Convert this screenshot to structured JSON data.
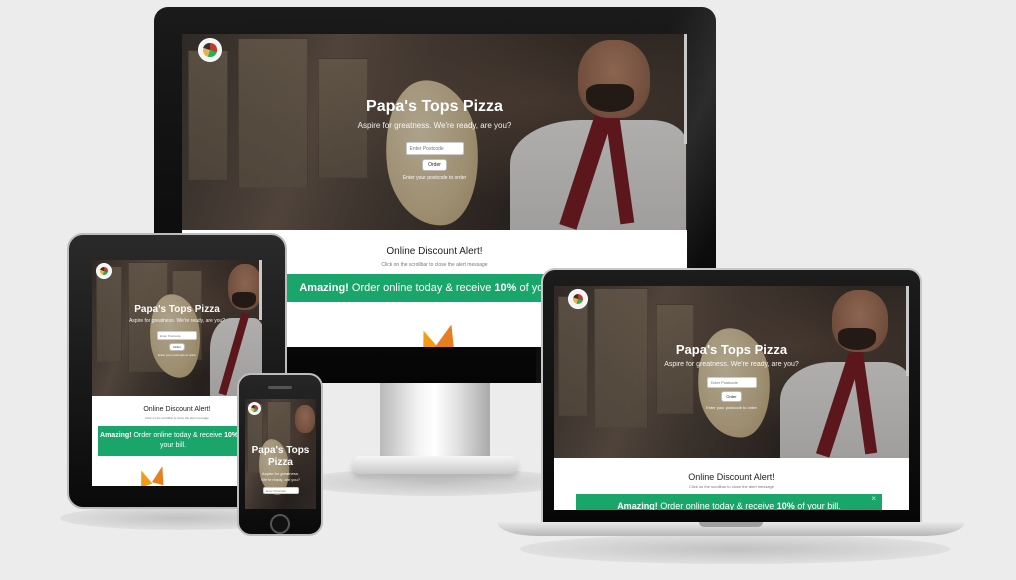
{
  "site": {
    "title": "Papa's Tops Pizza",
    "tagline": "Aspire for greatness. We're ready, are you?",
    "postcode_placeholder": "Enter Postcode",
    "order_label": "Order",
    "postcode_hint": "Enter your postcode to order",
    "discount_title": "Online Discount Alert!",
    "discount_subtitle": "Click on the scrollbar to close the alert message",
    "promo": {
      "lead": "Amazing!",
      "text": " Order online today & receive ",
      "highlight": "10%",
      "tail": " of your bill."
    },
    "close_symbol": "×"
  },
  "colors": {
    "promo_green": "#1aa56a",
    "apron_red": "#7a1b23",
    "flame_orange": "#f39c12"
  }
}
